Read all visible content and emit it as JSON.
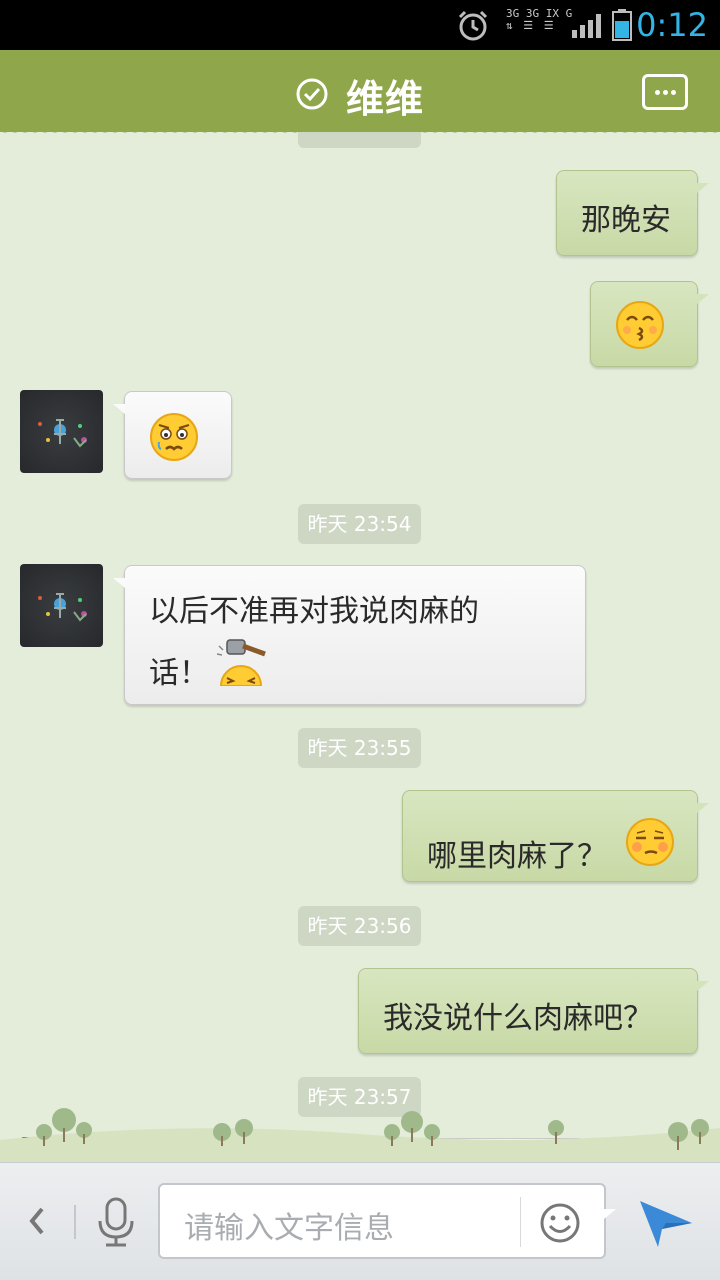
{
  "status_bar": {
    "time": "0:12",
    "network_labels": [
      "3G",
      "3G",
      "IX",
      "G"
    ],
    "icons": [
      "alarm-icon",
      "network-icon",
      "signal-icon",
      "battery-icon"
    ],
    "time_color": "#32b5e5"
  },
  "header": {
    "title": "维维",
    "icons": [
      "check-circle-icon",
      "more-icon"
    ],
    "color": "#8fa64b"
  },
  "chat": {
    "messages": [
      {
        "side": "out",
        "text": "那晚安"
      },
      {
        "side": "out",
        "emoji": "kiss-emoji"
      },
      {
        "side": "in",
        "emoji": "worried-emoji"
      },
      {
        "time": "昨天 23:54"
      },
      {
        "side": "in",
        "text_line1": "以后不准再对我说肉麻的",
        "text_line2": "话！",
        "emoji": "hammer-emoji"
      },
      {
        "time": "昨天 23:55"
      },
      {
        "side": "out",
        "text": "哪里肉麻了？",
        "emoji": "smug-emoji"
      },
      {
        "time": "昨天 23:56"
      },
      {
        "side": "out",
        "text": "我没说什么肉麻吧？"
      },
      {
        "time": "昨天 23:57"
      }
    ]
  },
  "composer": {
    "placeholder": "请输入文字信息",
    "icons": [
      "back-icon",
      "microphone-icon",
      "emoji-icon",
      "send-icon"
    ]
  }
}
